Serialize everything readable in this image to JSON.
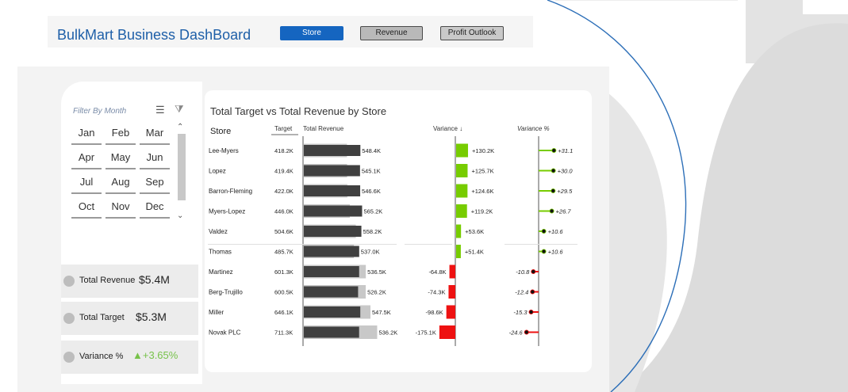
{
  "app": {
    "title": "BulkMart Business DashBoard",
    "nav": [
      {
        "label": "Store",
        "active": true
      },
      {
        "label": "Revenue",
        "active": false
      },
      {
        "label": "Profit Outlook",
        "active": false
      }
    ]
  },
  "filter": {
    "title": "Filter By Month",
    "months": [
      "Jan",
      "Feb",
      "Mar",
      "Apr",
      "May",
      "Jun",
      "Jul",
      "Aug",
      "Sep",
      "Oct",
      "Nov",
      "Dec"
    ],
    "icons": [
      "multi-select-icon",
      "clear-filter-icon"
    ]
  },
  "kpis": [
    {
      "label": "Total Revenue",
      "value": "$5.4M"
    },
    {
      "label": "Total Target",
      "value": "$5.3M"
    },
    {
      "label": "Variance %",
      "value": "▲+3.65%",
      "color": "#77c24a"
    }
  ],
  "colors": {
    "accent": "#1565c0",
    "title": "#1e5fa8",
    "revenue_bar": "#404040",
    "target_bar": "#c8c8c8",
    "positive": "#77cc00",
    "negative": "#ee1111"
  },
  "chart_data": {
    "type": "bar",
    "title": "Total Target vs Total Revenue by Store",
    "headers": {
      "store": "Store",
      "target": "Target",
      "revenue": "Total Revenue",
      "variance": "Variance ↓",
      "variance_pct": "Variance %"
    },
    "categories": [
      "Lee-Myers",
      "Lopez",
      "Barron-Fleming",
      "Myers-Lopez",
      "Valdez",
      "Thomas",
      "Martinez",
      "Berg-Trujillo",
      "Miller",
      "Novak PLC"
    ],
    "series": [
      {
        "name": "Target",
        "values": [
          418.2,
          419.4,
          422.0,
          446.0,
          504.6,
          485.7,
          601.3,
          600.5,
          646.1,
          711.3
        ],
        "labels": [
          "418.2K",
          "419.4K",
          "422.0K",
          "446.0K",
          "504.6K",
          "485.7K",
          "601.3K",
          "600.5K",
          "646.1K",
          "711.3K"
        ]
      },
      {
        "name": "Total Revenue",
        "values": [
          548.4,
          545.1,
          546.6,
          565.2,
          558.2,
          537.0,
          536.5,
          526.2,
          547.5,
          536.2
        ],
        "labels": [
          "548.4K",
          "545.1K",
          "546.6K",
          "565.2K",
          "558.2K",
          "537.0K",
          "536.5K",
          "526.2K",
          "547.5K",
          "536.2K"
        ]
      },
      {
        "name": "Variance",
        "values": [
          130.2,
          125.7,
          124.6,
          119.2,
          53.6,
          51.4,
          -64.8,
          -74.3,
          -98.6,
          -175.1
        ],
        "labels": [
          "+130.2K",
          "+125.7K",
          "+124.6K",
          "+119.2K",
          "+53.6K",
          "+51.4K",
          "-64.8K",
          "-74.3K",
          "-98.6K",
          "-175.1K"
        ]
      },
      {
        "name": "Variance %",
        "values": [
          31.1,
          30.0,
          29.5,
          26.7,
          10.6,
          10.6,
          -10.8,
          -12.4,
          -15.3,
          -24.6
        ],
        "labels": [
          "+31.1",
          "+30.0",
          "+29.5",
          "+26.7",
          "+10.6",
          "+10.6",
          "-10.8",
          "-12.4",
          "-15.3",
          "-24.6"
        ]
      }
    ]
  }
}
